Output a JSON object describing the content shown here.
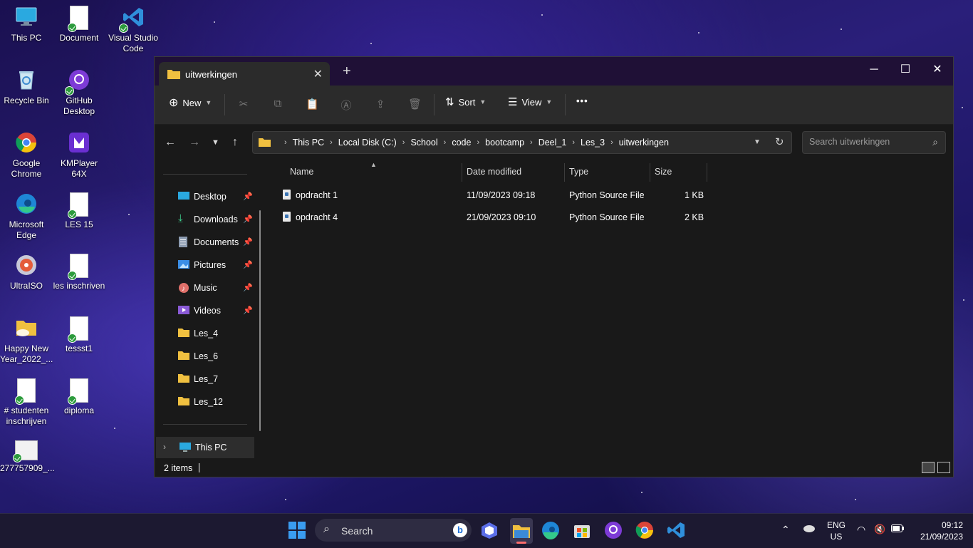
{
  "desktop": {
    "icons": [
      {
        "label": "This PC",
        "icon": "monitor-icon"
      },
      {
        "label": "Document",
        "icon": "document-icon"
      },
      {
        "label": "Visual Studio Code",
        "icon": "vscode-icon"
      },
      {
        "label": "Recycle Bin",
        "icon": "recycle-bin-icon"
      },
      {
        "label": "GitHub Desktop",
        "icon": "github-desktop-icon"
      },
      {
        "label": "Google Chrome",
        "icon": "chrome-icon"
      },
      {
        "label": "KMPlayer 64X",
        "icon": "kmplayer-icon"
      },
      {
        "label": "Microsoft Edge",
        "icon": "edge-icon"
      },
      {
        "label": "LES 15",
        "icon": "document-icon"
      },
      {
        "label": "UltraISO",
        "icon": "ultraiso-icon"
      },
      {
        "label": "les inschriven",
        "icon": "document-icon"
      },
      {
        "label": "Happy New Year_2022_...",
        "icon": "folder-icon"
      },
      {
        "label": "tessst1",
        "icon": "document-icon"
      },
      {
        "label": "# studenten inschrijven",
        "icon": "document-icon"
      },
      {
        "label": "diploma",
        "icon": "document-icon"
      },
      {
        "label": "277757909_...",
        "icon": "image-icon"
      }
    ]
  },
  "window": {
    "tab_title": "uitwerkingen",
    "toolbar": {
      "new_label": "New",
      "sort_label": "Sort",
      "view_label": "View",
      "more_label": "•••"
    },
    "breadcrumb": [
      "This PC",
      "Local Disk (C:)",
      "School",
      "code",
      "bootcamp",
      "Deel_1",
      "Les_3",
      "uitwerkingen"
    ],
    "search_placeholder": "Search uitwerkingen",
    "nav": {
      "quick_access": [
        {
          "label": "Desktop",
          "icon": "desktop-icon",
          "pinned": true
        },
        {
          "label": "Downloads",
          "icon": "download-icon",
          "pinned": true
        },
        {
          "label": "Documents",
          "icon": "documents-icon",
          "pinned": true
        },
        {
          "label": "Pictures",
          "icon": "pictures-icon",
          "pinned": true
        },
        {
          "label": "Music",
          "icon": "music-icon",
          "pinned": true
        },
        {
          "label": "Videos",
          "icon": "videos-icon",
          "pinned": true
        },
        {
          "label": "Les_4",
          "icon": "folder-icon",
          "pinned": false
        },
        {
          "label": "Les_6",
          "icon": "folder-icon",
          "pinned": false
        },
        {
          "label": "Les_7",
          "icon": "folder-icon",
          "pinned": false
        },
        {
          "label": "Les_12",
          "icon": "folder-icon",
          "pinned": false
        }
      ],
      "this_pc": "This PC"
    },
    "columns": {
      "name": "Name",
      "date": "Date modified",
      "type": "Type",
      "size": "Size"
    },
    "files": [
      {
        "name": "opdracht 1",
        "date": "11/09/2023 09:18",
        "type": "Python Source File",
        "size": "1 KB"
      },
      {
        "name": "opdracht 4",
        "date": "21/09/2023 09:10",
        "type": "Python Source File",
        "size": "2 KB"
      }
    ],
    "status": "2 items"
  },
  "taskbar": {
    "search_label": "Search",
    "lang_top": "ENG",
    "lang_bottom": "US",
    "time": "09:12",
    "date": "21/09/2023"
  },
  "colors": {
    "accent": "#f0c040",
    "window_bg": "#191919",
    "toolbar_bg": "#2b2b2b"
  }
}
